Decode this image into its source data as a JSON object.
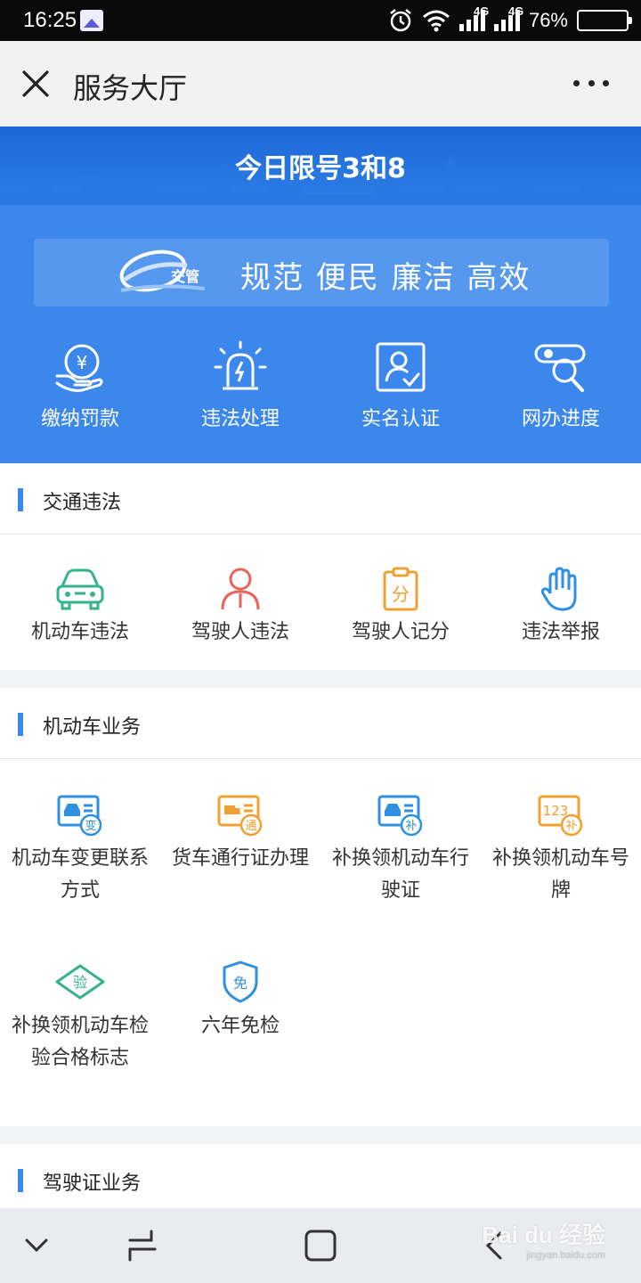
{
  "status": {
    "time": "16:25",
    "network1": "4G",
    "network2": "4G",
    "battery": "76%",
    "battery_level": 0.76
  },
  "header": {
    "title": "服务大厅"
  },
  "banner": {
    "limit_text": "今日限号3和8"
  },
  "slogan": {
    "logo_text": "交管",
    "text": "规范 便民 廉洁 高效"
  },
  "quick_actions": [
    {
      "label": "缴纳罚款",
      "icon": "yuan-hand-icon"
    },
    {
      "label": "违法处理",
      "icon": "police-light-icon"
    },
    {
      "label": "实名认证",
      "icon": "id-verify-icon"
    },
    {
      "label": "网办进度",
      "icon": "progress-search-icon"
    }
  ],
  "sections": [
    {
      "title": "交通违法",
      "items": [
        {
          "label": "机动车违法",
          "icon": "car-icon",
          "color": "#35b38d"
        },
        {
          "label": "驾驶人违法",
          "icon": "person-icon",
          "color": "#e8635a"
        },
        {
          "label": "驾驶人记分",
          "icon": "score-clipboard-icon",
          "color": "#f0a030",
          "glyph": "分"
        },
        {
          "label": "违法举报",
          "icon": "hand-icon",
          "color": "#2f8fe0"
        }
      ]
    },
    {
      "title": "机动车业务",
      "items": [
        {
          "label": "机动车变更联系方式",
          "icon": "change-card-icon",
          "color": "#2f8fe0",
          "glyph": "变"
        },
        {
          "label": "货车通行证办理",
          "icon": "truck-pass-icon",
          "color": "#f0a030",
          "glyph": "通"
        },
        {
          "label": "补换领机动车行驶证",
          "icon": "license-reissue-icon",
          "color": "#2f8fe0",
          "glyph": "补"
        },
        {
          "label": "补换领机动车号牌",
          "icon": "plate-reissue-icon",
          "color": "#f0a030",
          "glyph": "补",
          "plate": "123"
        },
        {
          "label": "补换领机动车检验合格标志",
          "icon": "inspection-mark-icon",
          "color": "#35b38d",
          "glyph": "验"
        },
        {
          "label": "六年免检",
          "icon": "shield-exempt-icon",
          "color": "#2f8fe0",
          "glyph": "免"
        }
      ]
    },
    {
      "title": "驾驶证业务"
    }
  ],
  "watermark": {
    "brand": "Bai du 经验",
    "url": "jingyan.baidu.com"
  },
  "colors": {
    "primary": "#3b87ec",
    "banner": "#1c68d8"
  }
}
